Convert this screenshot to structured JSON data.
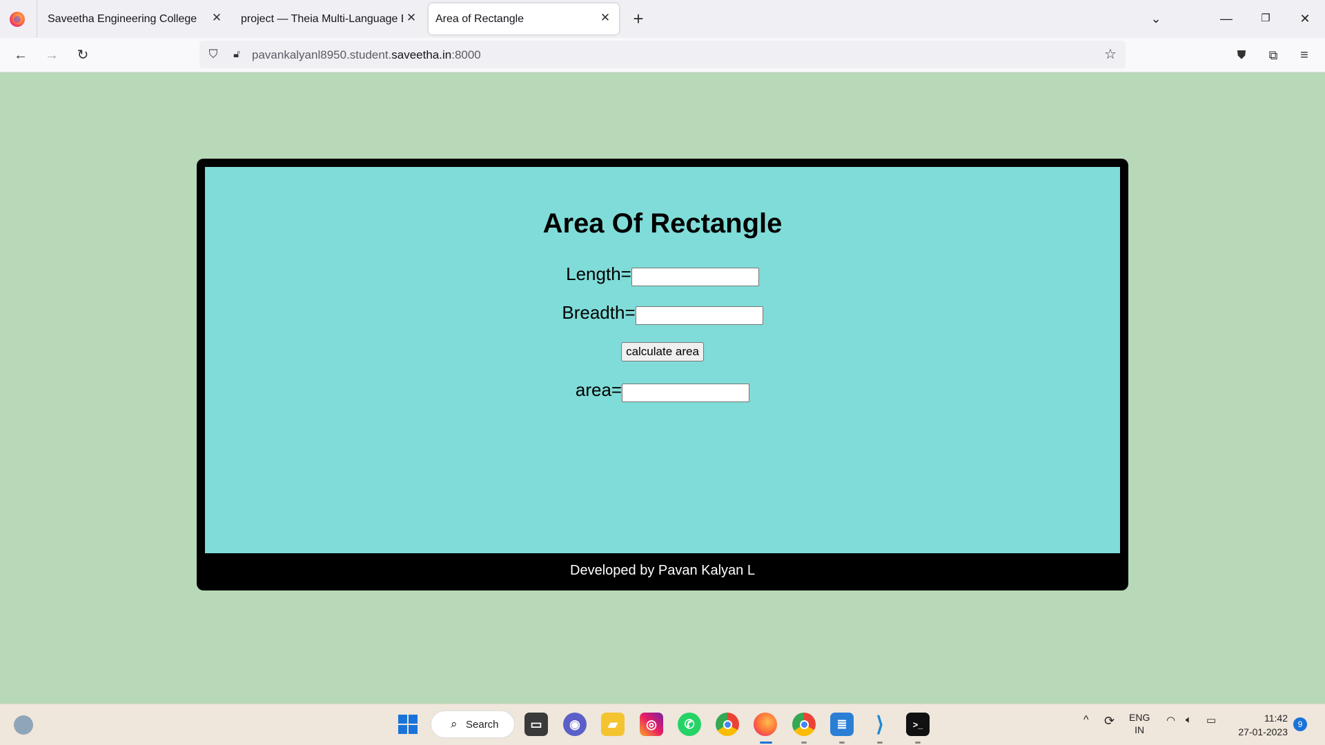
{
  "browser": {
    "tabs": [
      {
        "label": "Saveetha Engineering College"
      },
      {
        "label": "project — Theia Multi-Language Ex"
      },
      {
        "label": "Area of Rectangle"
      }
    ],
    "url_prefix": "pavankalyanl8950.student.",
    "url_domain": "saveetha.in",
    "url_suffix": ":8000"
  },
  "page": {
    "title": "Area Of Rectangle",
    "length_label": "Length=",
    "length_value": "",
    "breadth_label": "Breadth=",
    "breadth_value": "",
    "calc_button": "calculate area",
    "area_label": "area=",
    "area_value": "",
    "footer": "Developed by Pavan Kalyan L"
  },
  "taskbar": {
    "search_label": "Search",
    "lang_line1": "ENG",
    "lang_line2": "IN",
    "time": "11:42",
    "date": "27-01-2023",
    "notification_count": "9"
  }
}
